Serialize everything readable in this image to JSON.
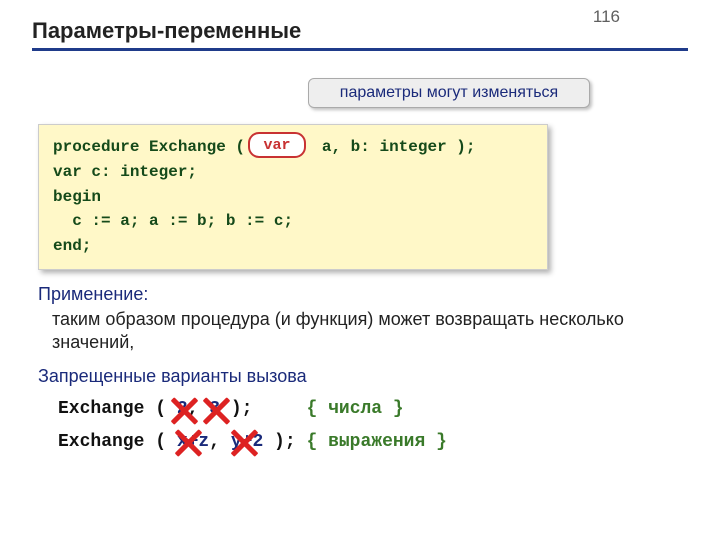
{
  "page_number": "116",
  "title": "Параметры-переменные",
  "callout": "параметры могут изменяться",
  "var_keyword": "var",
  "code": {
    "line1_pre": "procedure Exchange (",
    "line1_gap": "       ",
    "line1_post": " a, b: integer );",
    "line2": "var c: integer;",
    "line3": "begin",
    "line4": "  c := a; a := b; b := c;",
    "line5": "end;"
  },
  "usage": {
    "label": "Применение:",
    "text": "таким образом процедура (и функция) может возвращать несколько значений,"
  },
  "forbidden": {
    "label": "Запрещенные варианты вызова",
    "line1": {
      "call_pre": "Exchange ( ",
      "arg1": "2",
      "sep1": ", ",
      "arg2": "3",
      "call_post": " );     ",
      "comment": "{ числа }"
    },
    "line2": {
      "call_pre": "Exchange ( ",
      "arg1": "x+z",
      "sep1": ", ",
      "arg2": "y+2",
      "call_post": " ); ",
      "comment": "{ выражения }"
    }
  }
}
